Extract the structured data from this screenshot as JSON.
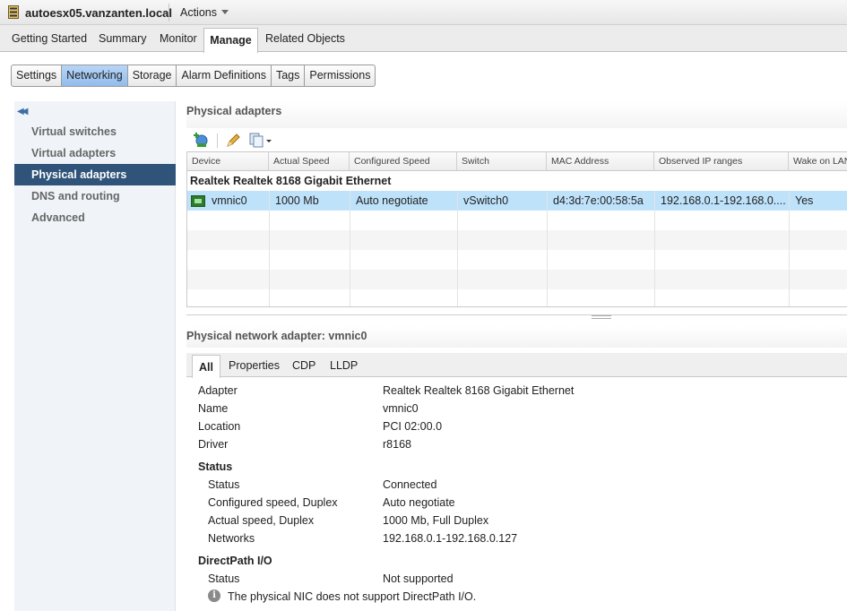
{
  "titlebar": {
    "host": "autoesx05.vanzanten.local",
    "actions_label": "Actions"
  },
  "main_tabs": [
    "Getting Started",
    "Summary",
    "Monitor",
    "Manage",
    "Related Objects"
  ],
  "sub_tabs": [
    "Settings",
    "Networking",
    "Storage",
    "Alarm Definitions",
    "Tags",
    "Permissions"
  ],
  "sub_tab_active": "Networking",
  "nav": {
    "items": [
      "Virtual switches",
      "Virtual adapters",
      "Physical adapters",
      "DNS and routing",
      "Advanced"
    ],
    "active": "Physical adapters"
  },
  "physical_adapters": {
    "title": "Physical adapters",
    "columns": [
      "Device",
      "Actual Speed",
      "Configured Speed",
      "Switch",
      "MAC Address",
      "Observed IP ranges",
      "Wake on LAN"
    ],
    "group_label": "Realtek Realtek 8168 Gigabit Ethernet",
    "rows": [
      {
        "device": "vmnic0",
        "actual_speed": "1000 Mb",
        "configured_speed": "Auto negotiate",
        "switch": "vSwitch0",
        "mac": "d4:3d:7e:00:58:5a",
        "ip_ranges": "192.168.0.1-192.168.0....",
        "wol": "Yes"
      }
    ]
  },
  "detail": {
    "title": "Physical network adapter: vmnic0",
    "tabs": [
      "All",
      "Properties",
      "CDP",
      "LLDP"
    ],
    "active_tab": "All",
    "adapter_label": "Adapter",
    "adapter_value": "Realtek Realtek 8168 Gigabit Ethernet",
    "name_label": "Name",
    "name_value": "vmnic0",
    "location_label": "Location",
    "location_value": "PCI 02:00.0",
    "driver_label": "Driver",
    "driver_value": "r8168",
    "status_section": "Status",
    "status_label": "Status",
    "status_value": "Connected",
    "conf_speed_label": "Configured speed, Duplex",
    "conf_speed_value": "Auto negotiate",
    "actual_speed_label": "Actual speed, Duplex",
    "actual_speed_value": "1000 Mb, Full Duplex",
    "networks_label": "Networks",
    "networks_value": "192.168.0.1-192.168.0.127",
    "directpath_section": "DirectPath I/O",
    "dp_status_label": "Status",
    "dp_status_value": "Not supported",
    "dp_note": "The physical NIC does not support DirectPath I/O."
  }
}
